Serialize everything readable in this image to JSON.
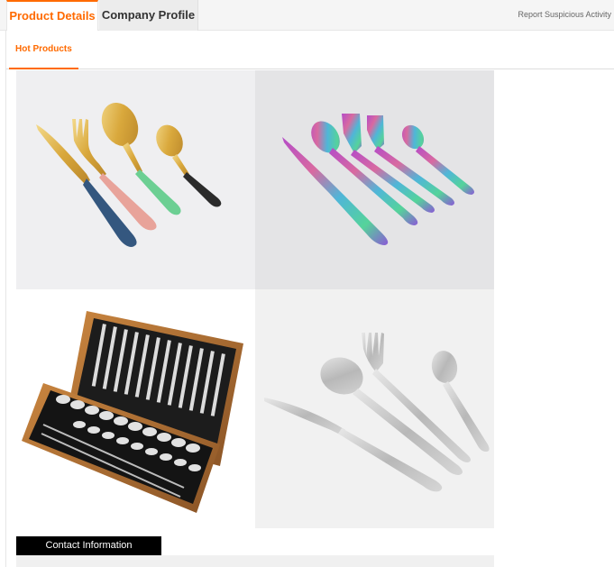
{
  "tabs": [
    {
      "label": "Product Details",
      "active": true
    },
    {
      "label": "Company Profile",
      "active": false
    }
  ],
  "report_link": "Report Suspicious Activity",
  "subtabs": [
    {
      "label": "Hot Products",
      "active": true
    }
  ],
  "products": [
    {
      "image": "gold-cutlery-set-icon"
    },
    {
      "image": "rainbow-cutlery-set-icon"
    },
    {
      "image": "cutlery-wooden-box-icon"
    },
    {
      "image": "silver-cutlery-set-icon"
    }
  ],
  "contact": {
    "title": "Contact Information"
  },
  "colors": {
    "accent": "#ff6a00",
    "tab_bar_bg": "#f5f5f5",
    "contact_bar_bg": "#000000"
  }
}
